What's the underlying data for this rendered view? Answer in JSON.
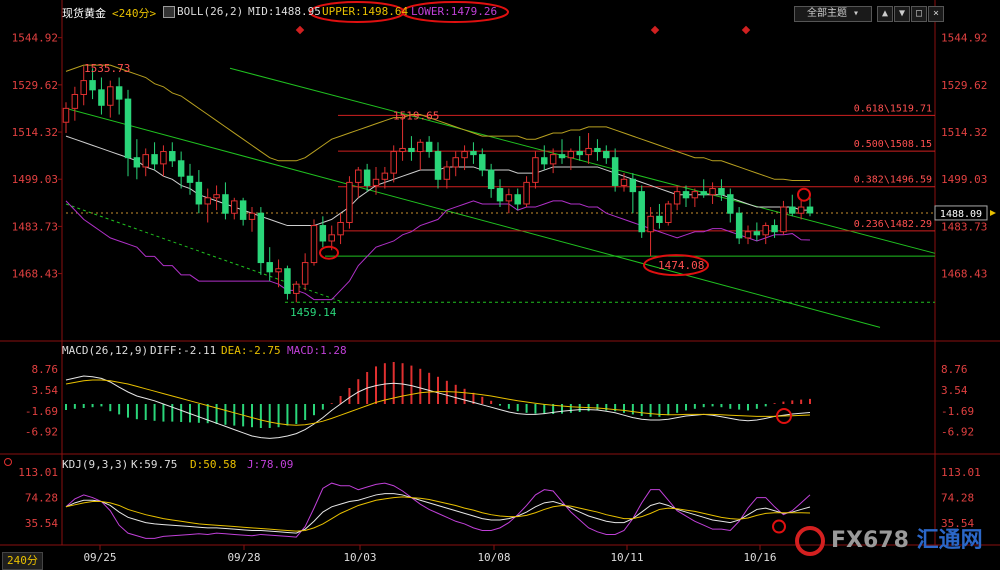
{
  "header": {
    "main_title": "现货黄金",
    "timeframe": "<240分>",
    "boll": "BOLL(26,2)",
    "mid": "MID:1488.95",
    "upper": "UPPER:1498.64",
    "lower": "LOWER:1479.26",
    "theme_button": "全部主题",
    "macd_title": "MACD(26,12,9)",
    "macd_diff": "DIFF:-2.11",
    "macd_dea": "DEA:-2.75",
    "macd_val": "MACD:1.28",
    "kdj_title": "KDJ(9,3,3)",
    "kdj_k": "K:59.75",
    "kdj_d": "D:50.58",
    "kdj_j": "J:78.09",
    "timeframe_tab": "240分",
    "logo_text": "FX678",
    "logo_cn": "汇通网"
  },
  "colors": {
    "up": "#e03030",
    "down": "#2ad67a",
    "mid": "#cfcfcf",
    "upper": "#b8a020",
    "lower": "#b030c8",
    "fib": "#d02020",
    "channel": "#20c020",
    "axis_text": "#e04040"
  },
  "chart_data": [
    {
      "type": "candlestick",
      "title": "现货黄金 <240分>",
      "ylim": [
        1455,
        1550
      ],
      "y_ticks": [
        "1544.92",
        "1529.62",
        "1514.32",
        "1499.03",
        "1483.73",
        "1468.43"
      ],
      "x_ticks": [
        "09/25",
        "09/28",
        "10/03",
        "10/08",
        "10/11",
        "10/16"
      ],
      "last_price": "1488.09",
      "ohlc": [
        [
          1517.5,
          1524,
          1514,
          1522
        ],
        [
          1522,
          1529,
          1518,
          1526.5
        ],
        [
          1526.5,
          1535.7,
          1523,
          1531
        ],
        [
          1531,
          1535,
          1525,
          1528
        ],
        [
          1528,
          1532,
          1520,
          1523
        ],
        [
          1523,
          1531,
          1519,
          1529
        ],
        [
          1529,
          1532,
          1520,
          1525
        ],
        [
          1525,
          1528,
          1500,
          1506
        ],
        [
          1506,
          1512,
          1499,
          1503
        ],
        [
          1503,
          1509,
          1500,
          1507
        ],
        [
          1507,
          1511,
          1502,
          1504
        ],
        [
          1504,
          1510,
          1500,
          1508
        ],
        [
          1508,
          1511,
          1503,
          1505
        ],
        [
          1505,
          1508,
          1496,
          1500
        ],
        [
          1500,
          1504,
          1494,
          1498
        ],
        [
          1498,
          1502,
          1488,
          1491
        ],
        [
          1491,
          1496,
          1485,
          1493
        ],
        [
          1493,
          1497,
          1489,
          1494
        ],
        [
          1494,
          1498,
          1486,
          1488
        ],
        [
          1488,
          1493,
          1486,
          1492
        ],
        [
          1492,
          1493,
          1484,
          1486
        ],
        [
          1486,
          1490,
          1482,
          1488
        ],
        [
          1488,
          1490,
          1468,
          1472
        ],
        [
          1472,
          1477,
          1466,
          1469
        ],
        [
          1469,
          1473,
          1464,
          1470
        ],
        [
          1470,
          1471,
          1460,
          1462
        ],
        [
          1462,
          1466,
          1459.1,
          1465
        ],
        [
          1465,
          1475,
          1463,
          1472
        ],
        [
          1472,
          1486,
          1471,
          1484
        ],
        [
          1484,
          1487,
          1477,
          1479
        ],
        [
          1479,
          1484,
          1476,
          1481
        ],
        [
          1481,
          1488,
          1478,
          1485
        ],
        [
          1485,
          1500,
          1483,
          1498
        ],
        [
          1498,
          1503,
          1493,
          1502
        ],
        [
          1502,
          1504,
          1495,
          1497
        ],
        [
          1497,
          1503,
          1494,
          1499
        ],
        [
          1499,
          1503,
          1496,
          1501
        ],
        [
          1501,
          1510,
          1498,
          1508
        ],
        [
          1508,
          1519.7,
          1505,
          1509
        ],
        [
          1509,
          1513,
          1505,
          1508
        ],
        [
          1508,
          1512,
          1502,
          1511
        ],
        [
          1511,
          1513,
          1506,
          1508
        ],
        [
          1508,
          1511,
          1496,
          1499
        ],
        [
          1499,
          1505,
          1496,
          1503
        ],
        [
          1503,
          1508,
          1500,
          1506
        ],
        [
          1506,
          1510,
          1502,
          1508
        ],
        [
          1508,
          1511,
          1504,
          1507
        ],
        [
          1507,
          1509,
          1500,
          1502
        ],
        [
          1502,
          1504,
          1493,
          1496
        ],
        [
          1496,
          1499,
          1490,
          1492
        ],
        [
          1492,
          1496,
          1488,
          1494
        ],
        [
          1494,
          1496,
          1489,
          1491
        ],
        [
          1491,
          1500,
          1490,
          1498
        ],
        [
          1498,
          1508,
          1496,
          1506
        ],
        [
          1506,
          1510,
          1502,
          1504
        ],
        [
          1504,
          1509,
          1501,
          1507
        ],
        [
          1507,
          1512,
          1504,
          1506
        ],
        [
          1506,
          1509,
          1502,
          1508
        ],
        [
          1508,
          1513,
          1505,
          1507
        ],
        [
          1507,
          1514,
          1504,
          1509
        ],
        [
          1509,
          1512,
          1505,
          1508
        ],
        [
          1508,
          1510,
          1504,
          1506
        ],
        [
          1506,
          1509,
          1495,
          1497
        ],
        [
          1497,
          1501,
          1495,
          1499
        ],
        [
          1499,
          1501,
          1488,
          1495
        ],
        [
          1495,
          1497,
          1480,
          1482
        ],
        [
          1482,
          1490,
          1474.1,
          1487
        ],
        [
          1487,
          1491,
          1483,
          1485
        ],
        [
          1485,
          1492,
          1484,
          1491
        ],
        [
          1491,
          1497,
          1489,
          1495
        ],
        [
          1495,
          1497,
          1490,
          1493
        ],
        [
          1493,
          1496,
          1490,
          1495
        ],
        [
          1495,
          1499,
          1493,
          1494
        ],
        [
          1494,
          1498,
          1491,
          1496
        ],
        [
          1496,
          1499,
          1492,
          1494
        ],
        [
          1494,
          1496,
          1485,
          1488
        ],
        [
          1488,
          1490,
          1478,
          1480
        ],
        [
          1480,
          1484,
          1478,
          1482
        ],
        [
          1482,
          1485,
          1479,
          1481
        ],
        [
          1481,
          1485,
          1478,
          1484
        ],
        [
          1484,
          1486,
          1480,
          1482
        ],
        [
          1482,
          1492,
          1481,
          1490
        ],
        [
          1490,
          1494,
          1487,
          1488
        ],
        [
          1488,
          1492,
          1486,
          1490
        ],
        [
          1490,
          1494,
          1487,
          1488.09
        ]
      ],
      "boll_mid": [
        1513,
        1512,
        1511,
        1510,
        1509,
        1508,
        1507,
        1506,
        1505,
        1503,
        1502,
        1500,
        1499,
        1497,
        1496,
        1494,
        1493,
        1492,
        1491,
        1490,
        1489,
        1488,
        1487,
        1486,
        1485,
        1484,
        1484,
        1484,
        1484,
        1485,
        1486,
        1488,
        1490,
        1493,
        1495,
        1497,
        1498,
        1499,
        1500,
        1501,
        1502,
        1502,
        1502,
        1503,
        1503,
        1503,
        1503,
        1502,
        1502,
        1502,
        1502,
        1501,
        1501,
        1501,
        1502,
        1503,
        1503,
        1503,
        1503,
        1503,
        1503,
        1502,
        1501,
        1500,
        1499,
        1498,
        1497,
        1496,
        1495,
        1494,
        1494,
        1494,
        1494,
        1494,
        1494,
        1493,
        1492,
        1491,
        1490,
        1490,
        1490,
        1490,
        1490,
        1489,
        1489
      ],
      "boll_upper": [
        1534,
        1535,
        1536,
        1536,
        1536,
        1536,
        1535,
        1534,
        1533,
        1532,
        1530,
        1529,
        1527,
        1526,
        1524,
        1522,
        1520,
        1518,
        1516,
        1514,
        1512,
        1510,
        1508,
        1506,
        1505,
        1505,
        1505,
        1506,
        1508,
        1510,
        1512,
        1513,
        1514,
        1515,
        1516,
        1517,
        1518,
        1519,
        1519,
        1520,
        1520,
        1519,
        1518,
        1517,
        1516,
        1515,
        1514,
        1513,
        1513,
        1513,
        1513,
        1513,
        1512,
        1512,
        1513,
        1514,
        1514,
        1515,
        1515,
        1516,
        1516,
        1516,
        1515,
        1514,
        1513,
        1512,
        1511,
        1510,
        1509,
        1508,
        1507,
        1506,
        1506,
        1505,
        1505,
        1504,
        1503,
        1502,
        1501,
        1500,
        1499,
        1499,
        1498.6,
        1498.6,
        1498.6
      ],
      "boll_lower": [
        1492,
        1489,
        1486,
        1484,
        1482,
        1480,
        1479,
        1478,
        1477,
        1474,
        1474,
        1471,
        1471,
        1468,
        1468,
        1466,
        1466,
        1466,
        1466,
        1466,
        1466,
        1466,
        1466,
        1466,
        1465,
        1463,
        1463,
        1462,
        1460,
        1460,
        1460,
        1463,
        1466,
        1471,
        1474,
        1477,
        1478,
        1479,
        1481,
        1482,
        1484,
        1485,
        1486,
        1489,
        1490,
        1491,
        1492,
        1491,
        1491,
        1491,
        1491,
        1489,
        1490,
        1490,
        1491,
        1492,
        1492,
        1491,
        1491,
        1490,
        1490,
        1488,
        1487,
        1486,
        1485,
        1484,
        1483,
        1482,
        1481,
        1480,
        1481,
        1482,
        1482,
        1483,
        1483,
        1482,
        1481,
        1480,
        1479,
        1480,
        1481,
        1481,
        1481.4,
        1479.4,
        1479.3
      ],
      "fib_levels": [
        {
          "label": "0.618\\1519.71",
          "value": 1519.71
        },
        {
          "label": "0.500\\1508.15",
          "value": 1508.15
        },
        {
          "label": "0.382\\1496.59",
          "value": 1496.59
        },
        {
          "label": "0.236\\1482.29",
          "value": 1482.29
        }
      ],
      "support_level": 1474.08,
      "support_low": 1459.14,
      "annotations": [
        "1535.73",
        "1519.65",
        "1474.08",
        "1459.14"
      ]
    },
    {
      "type": "bar",
      "title": "MACD(26,12,9)",
      "ylim": [
        -10,
        12
      ],
      "y_ticks": [
        "8.76",
        "3.54",
        "-1.69",
        "-6.92"
      ],
      "macd": [
        -1.5,
        -1.2,
        -1,
        -0.8,
        -0.6,
        -1.8,
        -2.6,
        -3.4,
        -3.8,
        -4,
        -4.2,
        -4.4,
        -4.4,
        -4.5,
        -4.6,
        -4.7,
        -4.8,
        -5,
        -5.2,
        -5.4,
        -5.6,
        -5.8,
        -6,
        -6,
        -5.8,
        -5.4,
        -5,
        -4,
        -2.8,
        -1.4,
        0.2,
        2,
        4,
        6.2,
        8,
        9.4,
        10.2,
        10.5,
        10.2,
        9.6,
        8.8,
        7.8,
        6.8,
        5.8,
        4.8,
        3.8,
        2.8,
        1.8,
        0.8,
        -0.4,
        -1.2,
        -1.8,
        -2.2,
        -2.4,
        -2.5,
        -2.5,
        -2.4,
        -2.2,
        -2.0,
        -1.8,
        -1.6,
        -1.6,
        -1.8,
        -2.2,
        -2.6,
        -3,
        -3.2,
        -3.2,
        -2.8,
        -2.2,
        -1.6,
        -1.2,
        -0.8,
        -0.6,
        -0.8,
        -1.2,
        -1.4,
        -1.6,
        -1.2,
        -0.6,
        0.2,
        0.6,
        0.9,
        1.1,
        1.28
      ],
      "diff": [
        6,
        6.5,
        7,
        6.8,
        6.4,
        5.5,
        4.2,
        3,
        2,
        1.4,
        0.8,
        0,
        -0.8,
        -1.6,
        -2.4,
        -3.2,
        -4,
        -4.8,
        -5.6,
        -6.4,
        -7.2,
        -8,
        -8.4,
        -8.6,
        -8.4,
        -8,
        -7.4,
        -6.4,
        -5,
        -3.4,
        -1.6,
        0,
        1.6,
        3,
        4,
        4.6,
        5,
        5.2,
        5,
        4.6,
        4,
        3.4,
        2.8,
        2.2,
        1.6,
        1,
        0.4,
        -0.2,
        -0.8,
        -1.4,
        -2,
        -2.4,
        -2.6,
        -2.6,
        -2.4,
        -2.1,
        -1.8,
        -1.6,
        -1.4,
        -1.4,
        -1.5,
        -1.8,
        -2.2,
        -2.8,
        -3.4,
        -3.8,
        -4,
        -4,
        -3.8,
        -3.4,
        -3,
        -2.8,
        -2.6,
        -2.8,
        -3.2,
        -3.6,
        -4,
        -4.2,
        -4,
        -3.6,
        -3.1,
        -2.8,
        -2.5,
        -2.3,
        -2.11
      ],
      "dea": [
        5,
        5.4,
        5.8,
        6,
        6,
        5.8,
        5.4,
        5,
        4.4,
        3.8,
        3.2,
        2.6,
        2,
        1.4,
        0.8,
        0.2,
        -0.4,
        -1,
        -1.6,
        -2.2,
        -2.8,
        -3.4,
        -4,
        -4.5,
        -4.9,
        -5.2,
        -5.3,
        -5.2,
        -4.8,
        -4.3,
        -3.6,
        -2.8,
        -2,
        -1.2,
        -0.4,
        0.4,
        1,
        1.5,
        2,
        2.4,
        2.8,
        3,
        3.1,
        3.1,
        3,
        2.8,
        2.6,
        2.3,
        2,
        1.6,
        1.2,
        0.8,
        0.5,
        0.2,
        -0.1,
        -0.3,
        -0.5,
        -0.7,
        -0.8,
        -0.9,
        -1,
        -1.2,
        -1.4,
        -1.6,
        -1.9,
        -2.2,
        -2.4,
        -2.6,
        -2.7,
        -2.7,
        -2.6,
        -2.6,
        -2.6,
        -2.6,
        -2.7,
        -2.8,
        -2.9,
        -3,
        -3.1,
        -3.1,
        -3.1,
        -3,
        -2.95,
        -2.85,
        -2.75
      ]
    },
    {
      "type": "line",
      "title": "KDJ(9,3,3)",
      "ylim": [
        5,
        125
      ],
      "y_ticks": [
        "113.01",
        "74.28",
        "35.54"
      ],
      "k": [
        60,
        66,
        70,
        70,
        68,
        62,
        52,
        44,
        40,
        36,
        34,
        33,
        32,
        31,
        30,
        29,
        28,
        28,
        27,
        26,
        25,
        24,
        24,
        23,
        22,
        21,
        20,
        26,
        38,
        52,
        60,
        64,
        68,
        70,
        74,
        78,
        80,
        80,
        78,
        74,
        70,
        66,
        62,
        58,
        54,
        50,
        46,
        42,
        40,
        40,
        42,
        46,
        52,
        60,
        66,
        68,
        64,
        58,
        52,
        46,
        42,
        38,
        36,
        36,
        42,
        52,
        62,
        66,
        62,
        56,
        52,
        48,
        44,
        40,
        38,
        36,
        40,
        48,
        56,
        58,
        54,
        50,
        52,
        56,
        59.75
      ],
      "d": [
        60,
        63,
        66,
        68,
        68,
        66,
        62,
        56,
        52,
        48,
        45,
        42,
        40,
        38,
        36,
        34,
        33,
        32,
        31,
        30,
        29,
        28,
        27,
        26,
        25,
        24,
        23,
        24,
        28,
        34,
        42,
        50,
        56,
        62,
        66,
        70,
        72,
        74,
        75,
        74,
        73,
        71,
        68,
        65,
        62,
        58,
        55,
        51,
        48,
        46,
        45,
        45,
        47,
        51,
        56,
        60,
        62,
        61,
        58,
        55,
        52,
        48,
        45,
        42,
        42,
        45,
        50,
        56,
        58,
        57,
        55,
        53,
        50,
        47,
        44,
        42,
        41,
        43,
        47,
        50,
        51,
        51,
        51,
        51,
        50.58
      ],
      "j": [
        60,
        72,
        78,
        74,
        68,
        54,
        32,
        20,
        16,
        12,
        12,
        15,
        16,
        17,
        18,
        19,
        18,
        20,
        19,
        18,
        17,
        16,
        18,
        17,
        16,
        15,
        14,
        30,
        58,
        88,
        96,
        92,
        92,
        86,
        90,
        94,
        96,
        92,
        84,
        74,
        64,
        56,
        50,
        44,
        38,
        34,
        28,
        24,
        24,
        28,
        36,
        48,
        62,
        78,
        86,
        84,
        68,
        52,
        40,
        28,
        22,
        18,
        18,
        24,
        42,
        66,
        86,
        86,
        70,
        54,
        46,
        38,
        32,
        26,
        26,
        24,
        38,
        58,
        74,
        74,
        60,
        48,
        54,
        66,
        78.09
      ]
    }
  ]
}
